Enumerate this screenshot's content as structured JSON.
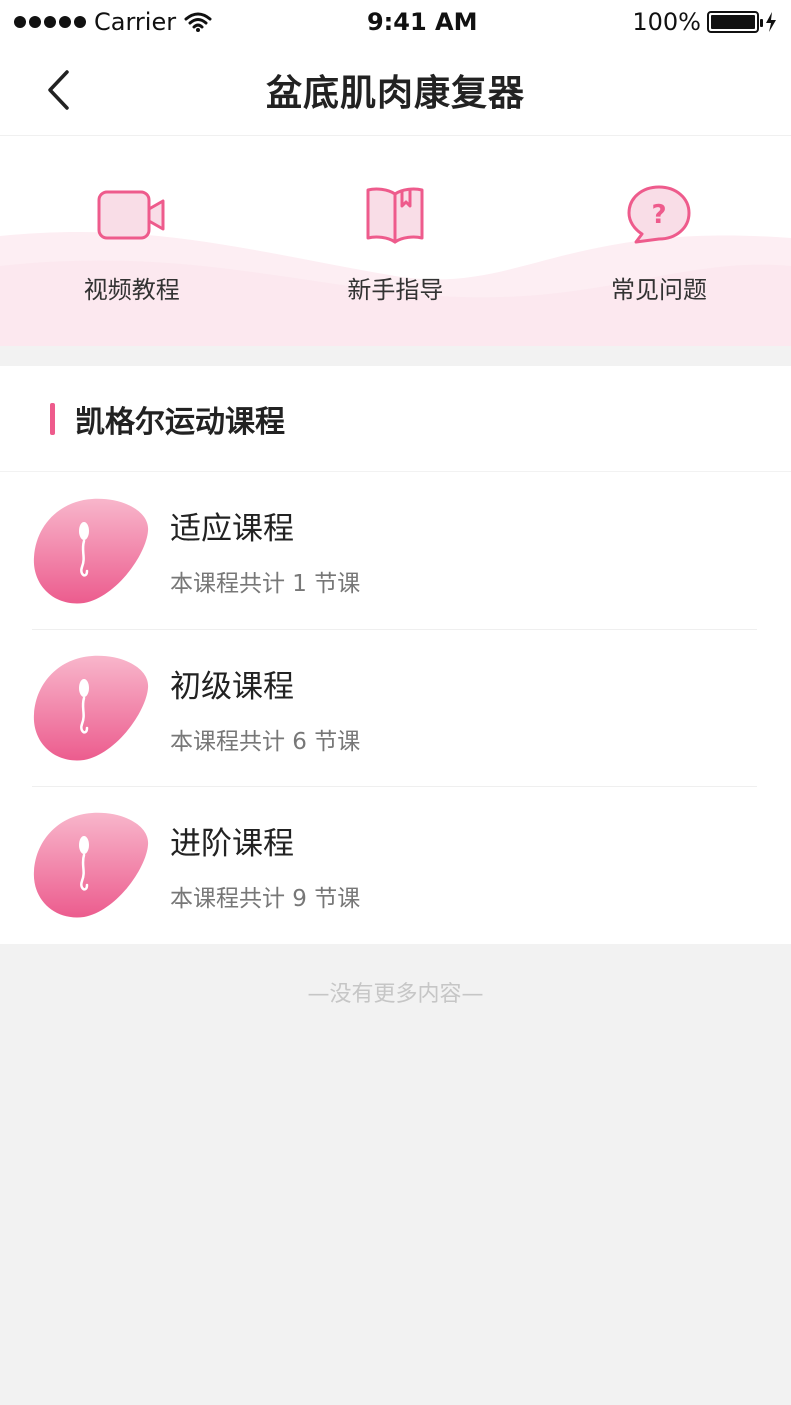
{
  "status_bar": {
    "carrier": "Carrier",
    "time": "9:41 AM",
    "battery": "100%"
  },
  "nav": {
    "title": "盆底肌肉康复器",
    "back_icon": "chevron-left-icon"
  },
  "quick_links": [
    {
      "label": "视频教程",
      "icon": "video-camera-icon"
    },
    {
      "label": "新手指导",
      "icon": "book-icon"
    },
    {
      "label": "常见问题",
      "icon": "question-bubble-icon"
    }
  ],
  "section": {
    "title": "凯格尔运动课程",
    "courses": [
      {
        "title": "适应课程",
        "subtitle": "本课程共计 1 节课"
      },
      {
        "title": "初级课程",
        "subtitle": "本课程共计 6 节课"
      },
      {
        "title": "进阶课程",
        "subtitle": "本课程共计 9 节课"
      }
    ]
  },
  "footer": {
    "note": "—没有更多内容—"
  },
  "colors": {
    "accent": "#ee5b8c",
    "icon_fill": "#f9dde7",
    "wave": "#fdeef3"
  }
}
